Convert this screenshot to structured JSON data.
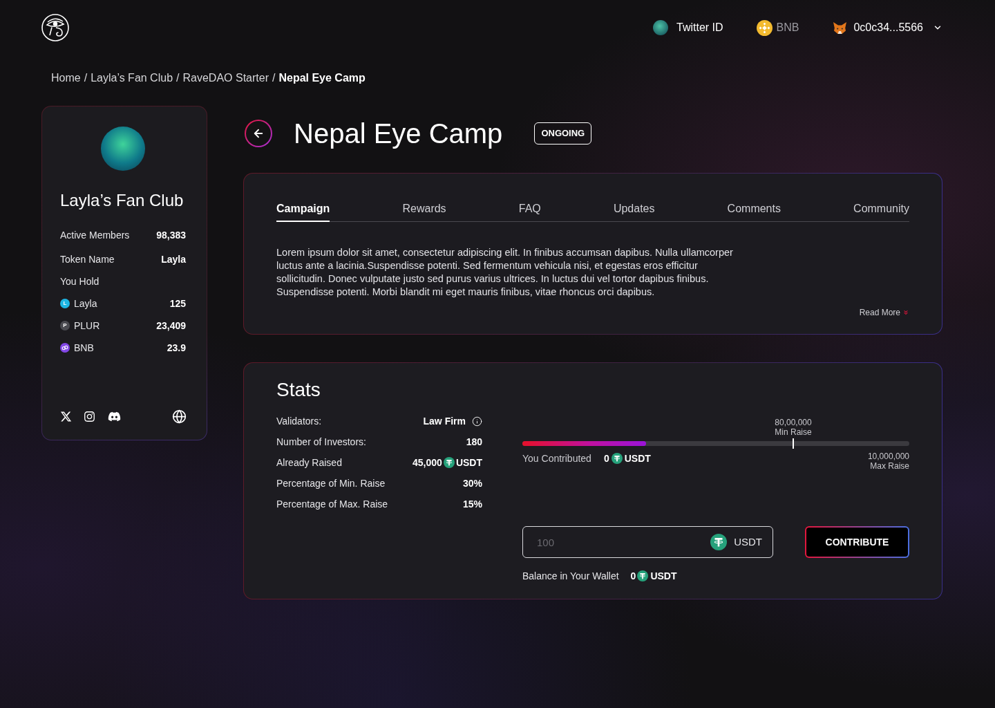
{
  "header": {
    "account": {
      "label": "Twitter ID"
    },
    "network": {
      "label": "BNB"
    },
    "wallet": {
      "address": "0c0c34...5566"
    }
  },
  "breadcrumb": {
    "separator": "/",
    "items": [
      {
        "label": "Home",
        "current": false
      },
      {
        "label": "Layla’s Fan Club",
        "current": false
      },
      {
        "label": "RaveDAO Starter",
        "current": false
      },
      {
        "label": "Nepal Eye Camp",
        "current": true
      }
    ]
  },
  "club": {
    "name": "Layla’s Fan Club",
    "stats": [
      {
        "label": "Active Members",
        "value": "98,383"
      },
      {
        "label": "Token Name",
        "value": "Layla"
      }
    ],
    "holdings_title": "You Hold",
    "holdings": [
      {
        "symbol": "L",
        "name": "Layla",
        "amount": "125",
        "color": "#1eb6e4"
      },
      {
        "symbol": "P",
        "name": "PLUR",
        "amount": "23,409",
        "color": "#4a4a50"
      },
      {
        "name": "BNB",
        "amount": "23.9",
        "color": "#8247e5"
      }
    ]
  },
  "campaign": {
    "title": "Nepal Eye Camp",
    "status": "ONGOING",
    "tabs": [
      {
        "label": "Campaign",
        "selected": true
      },
      {
        "label": "Rewards",
        "selected": false
      },
      {
        "label": "FAQ",
        "selected": false
      },
      {
        "label": "Updates",
        "selected": false
      },
      {
        "label": "Comments",
        "selected": false
      },
      {
        "label": "Community",
        "selected": false
      }
    ],
    "description": "Lorem ipsum dolor sit amet, consectetur adipiscing elit. In finibus accumsan dapibus. Nulla ullamcorper luctus ante a lacinia.Suspendisse potenti. Sed fermentum vehicula nisi, et egestas eros efficitur sollicitudin. Donec vulputate justo sed purus varius ultrices. In luctus dui vel tortor dapibus finibus. Suspendisse potenti. Morbi blandit mi eget mauris finibus, vitae rhoncus orci dapibus.",
    "read_more": "Read More"
  },
  "stats": {
    "title": "Stats",
    "rows": [
      {
        "kind": "info",
        "label": "Validators:",
        "value": "Law Firm"
      },
      {
        "kind": "plain",
        "label": "Number of Investors:",
        "value": "180"
      },
      {
        "kind": "currency",
        "label": "Already Raised",
        "amount": "45,000",
        "unit": "USDT"
      },
      {
        "kind": "plain",
        "label": "Percentage of Min. Raise",
        "value": "30%"
      },
      {
        "kind": "plain",
        "label": "Percentage of Max. Raise",
        "value": "15%"
      }
    ],
    "progress": {
      "level": 0.32,
      "min_raise": {
        "amount": "80,00,000",
        "label": "Min Raise",
        "level": 0.7
      },
      "max_raise": {
        "amount": "10,000,000",
        "label": "Max Raise"
      },
      "contributed": {
        "label": "You Contributed",
        "amount": "0",
        "unit": "USDT"
      }
    },
    "amount_field": {
      "placeholder": "100",
      "unit": "USDT"
    },
    "contribute_button": "CONTRIBUTE",
    "balance": {
      "label": "Balance in Your Wallet",
      "amount": "0",
      "unit": "USDT"
    }
  }
}
